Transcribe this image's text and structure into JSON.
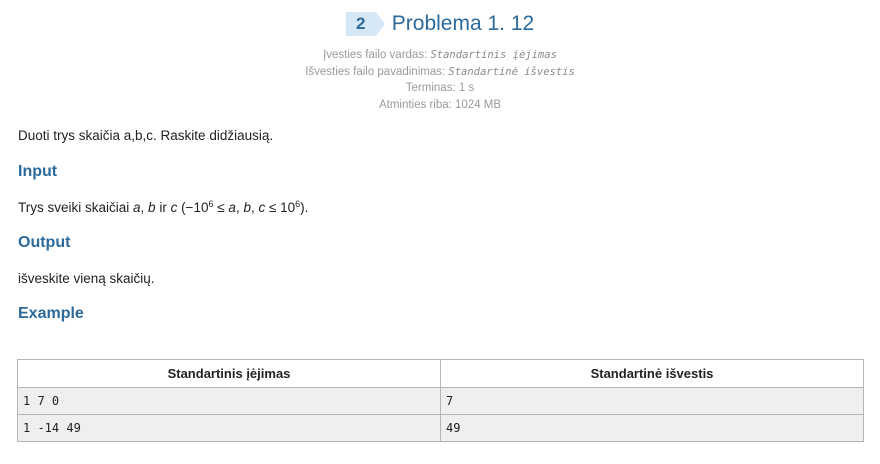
{
  "problem": {
    "number": "2",
    "title": "Problema 1. 12"
  },
  "meta": {
    "input_file_label": "Įvesties failo vardas:",
    "input_file_value": "Standartinis įėjimas",
    "output_file_label": "Išvesties failo pavadinimas:",
    "output_file_value": "Standartinė išvestis",
    "time_limit": "Terminas: 1 s",
    "memory_limit": "Atminties riba: 1024 MB"
  },
  "statement": "Duoti trys skaičia a,b,c. Raskite didžiausią.",
  "input_section": {
    "heading": "Input",
    "text_prefix": "Trys sveiki skaičiai ",
    "var_a": "a",
    "comma_space": ", ",
    "var_b": "b",
    "and_word": " ir ",
    "var_c": "c",
    "range_open": " (−10",
    "exp1": "6",
    "range_mid": " ≤ ",
    "range_a": "a",
    "range_sep1": ", ",
    "range_b": "b",
    "range_sep2": ", ",
    "range_c": "c",
    "range_le": " ≤ 10",
    "exp2": "6",
    "range_close": ")."
  },
  "output_section": {
    "heading": "Output",
    "text": "išveskite vieną skaičių."
  },
  "example": {
    "heading": "Example",
    "columns": [
      "Standartinis įėjimas",
      "Standartinė išvestis"
    ],
    "rows": [
      [
        "1 7 0",
        "7"
      ],
      [
        "1 -14 49",
        "49"
      ]
    ]
  }
}
